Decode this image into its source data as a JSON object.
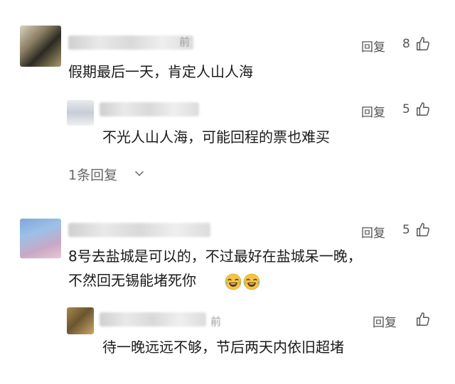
{
  "comments": [
    {
      "text": "假期最后一天，肯定人山人海",
      "reply_label": "回复",
      "likes": "8",
      "name_fragment": "前",
      "replies": [
        {
          "text": "不光人山人海，可能回程的票也难买",
          "reply_label": "回复",
          "likes": "5"
        }
      ],
      "more_replies": "1条回复"
    },
    {
      "text_line1": "8号去盐城是可以的，不过最好在盐城呆一晚，",
      "text_line2": "不然回无锡能堵死你",
      "reply_label": "回复",
      "likes": "5",
      "replies": [
        {
          "text": "待一晚远远不够，节后两天内依旧超堵",
          "reply_label": "回复",
          "likes": "",
          "name_fragment": "前"
        }
      ]
    }
  ],
  "icons": {
    "like": "thumbs-up-outline-icon",
    "expand": "chevron-down-icon",
    "emoji": "tears-of-joy-emoji"
  },
  "colors": {
    "text": "#1a1a1a",
    "meta": "#555555",
    "emoji": "#f6c343"
  }
}
